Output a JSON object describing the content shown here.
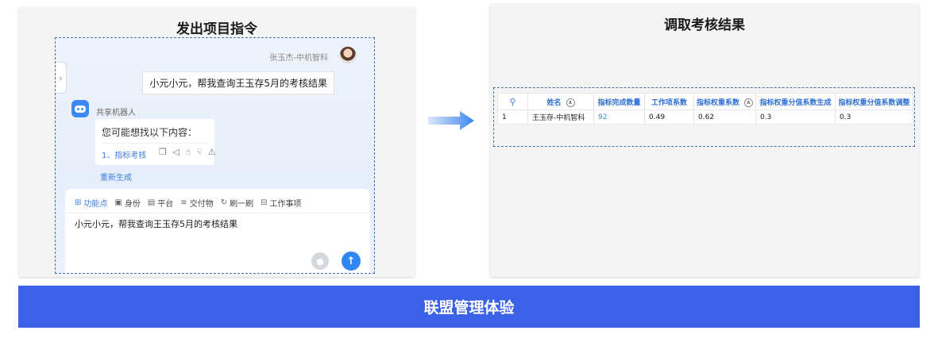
{
  "left_panel": {
    "title": "发出项目指令",
    "user": {
      "name": "张玉杰-中机智科",
      "message": "小元小元，帮我查询王玉存5月的考核结果"
    },
    "bot": {
      "name": "共享机器人",
      "question": "您可能想找以下内容：",
      "suggestion": "1、指标考核",
      "action_icons": [
        "copy-icon",
        "send-icon",
        "thumbs-up-icon",
        "thumbs-down-icon",
        "warning-icon"
      ],
      "regenerate": "重新生成"
    },
    "toolbar": [
      {
        "label": "功能点",
        "icon": "grid-icon"
      },
      {
        "label": "身份",
        "icon": "id-card-icon"
      },
      {
        "label": "平台",
        "icon": "platform-icon"
      },
      {
        "label": "交付物",
        "icon": "layers-icon"
      },
      {
        "label": "刷一刷",
        "icon": "refresh-icon"
      },
      {
        "label": "工作事项",
        "icon": "task-icon"
      }
    ],
    "input_value": "小元小元，帮我查询王玉存5月的考核结果"
  },
  "right_panel": {
    "title": "调取考核结果",
    "table": {
      "columns": [
        "姓名",
        "指标完成数量",
        "工作项系数",
        "指标权重系数",
        "指标权重分值系数生成",
        "指标权重分值系数调整"
      ],
      "rows": [
        [
          "1",
          "王玉存-中机智科",
          "92",
          "0.49",
          "0.62",
          "0.3",
          "0.3"
        ]
      ]
    }
  },
  "banner": {
    "text": "联盟管理体验"
  },
  "colors": {
    "accent": "#3c7fe6",
    "banner": "#3b62e6",
    "dashed_border": "#4a6fa5"
  }
}
